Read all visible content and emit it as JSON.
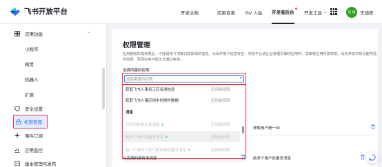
{
  "brand": {
    "title": "飞书开放平台"
  },
  "nav": {
    "items": [
      "开发文档",
      "应用目录",
      "ISV 入驻",
      "开发者后台",
      "开发工具"
    ],
    "active_index": 3
  },
  "user": {
    "avatar_text": "包 杨",
    "name": "王旭栋"
  },
  "sidebar": {
    "items": [
      {
        "label": "应用功能",
        "icon": "app-feature-icon"
      },
      {
        "label": "小程序"
      },
      {
        "label": "网页"
      },
      {
        "label": "机器人"
      },
      {
        "label": "扩展"
      },
      {
        "label": "安全设置",
        "icon": "shield-icon"
      },
      {
        "label": "权限管理",
        "icon": "lock-icon",
        "active": true
      },
      {
        "label": "事件订阅",
        "icon": "event-icon"
      },
      {
        "label": "应用监控",
        "icon": "monitor-icon"
      },
      {
        "label": "版本管理与发布",
        "icon": "version-icon"
      }
    ]
  },
  "main": {
    "title": "权限管理",
    "description": "应用拥有所需权限后，才能调用飞书接口获取相关信息。为保护用户信息安全，开放平台或企业管理员审核应用时，需审核应用所需权限。请仅开启实现功能所需的权限，否则应用可能无法通过审核。",
    "select_label": "选择所需的权限",
    "select_placeholder": "选择需要的权限"
  },
  "dropdown": {
    "options": [
      {
        "name": "获取飞书人事员工花名册信息",
        "type": "应用级权限",
        "state": "normal"
      },
      {
        "name": "获取飞书人事应用中的附件数据",
        "type": "应用级权限",
        "state": "normal"
      },
      {
        "group": "消息"
      },
      {
        "name": "以应用的身份发消息",
        "type": "应用级权限",
        "state": "disabled",
        "checked": true
      },
      {
        "name": "给多个用户批量发消息",
        "type": "应用级权限",
        "state": "hover",
        "checked": true
      },
      {
        "name": "给一个或多个部门的成员批量发消息",
        "type": "应用级权限",
        "state": "disabled"
      }
    ]
  },
  "right_rows": [
    {
      "label": "获取用户统一ID"
    },
    {
      "label": "给多个用户批量发消息"
    }
  ],
  "bottom_left": {
    "label": "以应用的身份发消息"
  },
  "colors": {
    "accent": "#3370ff",
    "highlight_border": "#f0384c",
    "success": "#34c724"
  }
}
